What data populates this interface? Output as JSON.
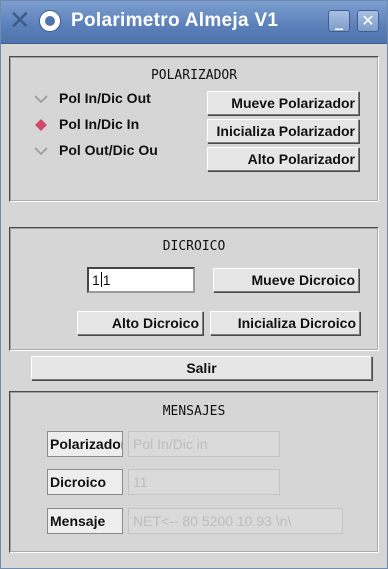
{
  "window": {
    "title": "Polarimetro Almeja V1",
    "minimize_glyph": "_",
    "close_glyph": "✕"
  },
  "polarizador": {
    "title": "POLARIZADOR",
    "options": [
      {
        "label": "Pol In/Dic Out",
        "selected": false
      },
      {
        "label": "Pol In/Dic In",
        "selected": true
      },
      {
        "label": "Pol Out/Dic Ou",
        "selected": false
      }
    ],
    "buttons": {
      "mueve": "Mueve Polarizador",
      "inicializa": "Inicializa Polarizador",
      "alto": "Alto Polarizador"
    }
  },
  "dicroico": {
    "title": "DICROICO",
    "value_before_caret": "1",
    "value_after_caret": "1",
    "buttons": {
      "mueve": "Mueve Dicroico",
      "alto": "Alto Dicroico",
      "inicializa": "Inicializa Dicroico"
    }
  },
  "salir": {
    "label": "Salir"
  },
  "mensajes": {
    "title": "MENSAJES",
    "rows": [
      {
        "label": "Polarizador",
        "value": "Pol In/Dic in"
      },
      {
        "label": "Dicroico",
        "value": "11"
      },
      {
        "label": "Mensaje",
        "value": "NET<-- 80 5200 10.93 \\n\\"
      }
    ]
  },
  "colors": {
    "titlebar": "#5d82bb",
    "window_bg": "#d6d6d6",
    "radio_selected": "#d0486a",
    "radio_unselected": "#9a9a9a"
  }
}
